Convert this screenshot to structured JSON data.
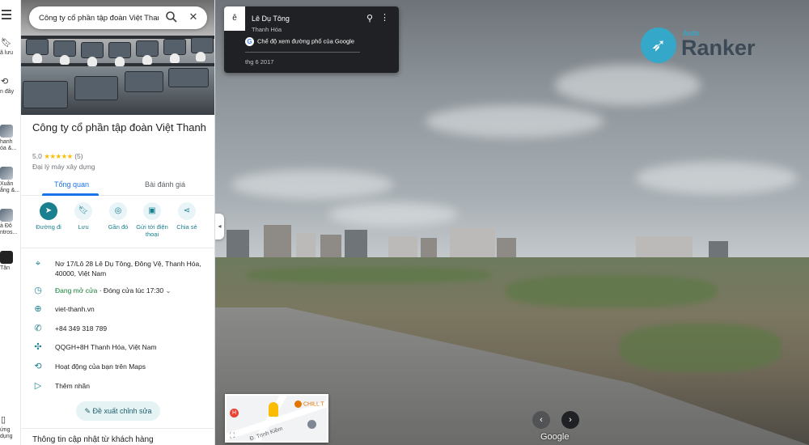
{
  "rail": {
    "saved_label": "ã lưu",
    "recent_label": "n đây",
    "items": [
      {
        "label": "hanh\nóa &..."
      },
      {
        "label": "Xuân\nắng &..."
      },
      {
        "label": "à Đô\nntros..."
      },
      {
        "label": "Tân"
      }
    ],
    "bottom_label": "ứng\ndụng"
  },
  "search": {
    "value": "Công ty cổ phần tập đoàn Việt Thanh"
  },
  "place": {
    "title": "Công ty cổ phần tập đoàn Việt Thanh",
    "rating": "5,0",
    "stars": "★★★★★",
    "review_count": "(5)",
    "category": "Đại lý máy xây dựng"
  },
  "tabs": [
    {
      "label": "Tổng quan"
    },
    {
      "label": "Bài đánh giá"
    }
  ],
  "actions": [
    {
      "label": "Đường đi"
    },
    {
      "label": "Lưu"
    },
    {
      "label": "Gần đó"
    },
    {
      "label": "Gửi tới điện thoại"
    },
    {
      "label": "Chia sẻ"
    }
  ],
  "info": {
    "address": "Nơ 17/Lô 28 Lê Dụ Tông, Đông Vệ, Thanh Hóa, 40000, Việt Nam",
    "hours_status": "Đang mở cửa",
    "hours_detail": " · Đóng cửa lúc 17:30",
    "website": "viet-thanh.vn",
    "phone": "+84 349 318 789",
    "plus_code": "QQGH+8H Thanh Hóa, Việt Nam",
    "activity": "Hoạt động của bạn trên Maps",
    "add_label": "Thêm nhãn"
  },
  "suggest_label": "Đề xuất chỉnh sửa",
  "update_heading": "Thông tin cập nhật từ khách hàng",
  "streetview": {
    "street": "Lê Dụ Tông",
    "city": "Thanh Hóa",
    "mode": "Chế độ xem đường phố của Google",
    "date": "thg 6 2017",
    "back_letter": "ê",
    "watermark": "Google"
  },
  "brand": {
    "auto": "Auto",
    "ranker": "Ranker"
  },
  "minimap": {
    "poi": "CHILL T",
    "road": "Đ. Trịnh Kiềm",
    "hospital": "H"
  }
}
